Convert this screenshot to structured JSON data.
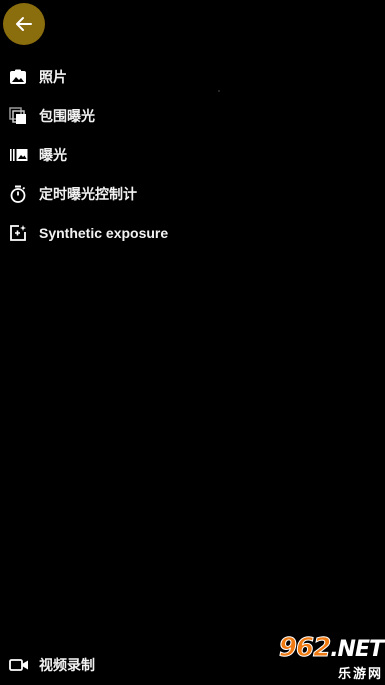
{
  "colors": {
    "background": "#000000",
    "back_button": "#8a6d0c",
    "text": "#f2f2f2",
    "watermark_accent": "#f07a12"
  },
  "back_button": {
    "icon": "arrow-left-icon"
  },
  "menu": {
    "items": [
      {
        "label": "照片",
        "icon": "photo-icon"
      },
      {
        "label": "包围曝光",
        "icon": "bracket-exposure-icon"
      },
      {
        "label": "曝光",
        "icon": "exposure-icon"
      },
      {
        "label": "定时曝光控制计",
        "icon": "timer-icon"
      },
      {
        "label": "Synthetic exposure",
        "icon": "synthetic-exposure-icon"
      },
      {
        "label": "视频录制",
        "icon": "video-camera-icon"
      }
    ]
  },
  "watermark": {
    "number": "962",
    "domain": ".NET",
    "subtitle": "乐游网"
  }
}
